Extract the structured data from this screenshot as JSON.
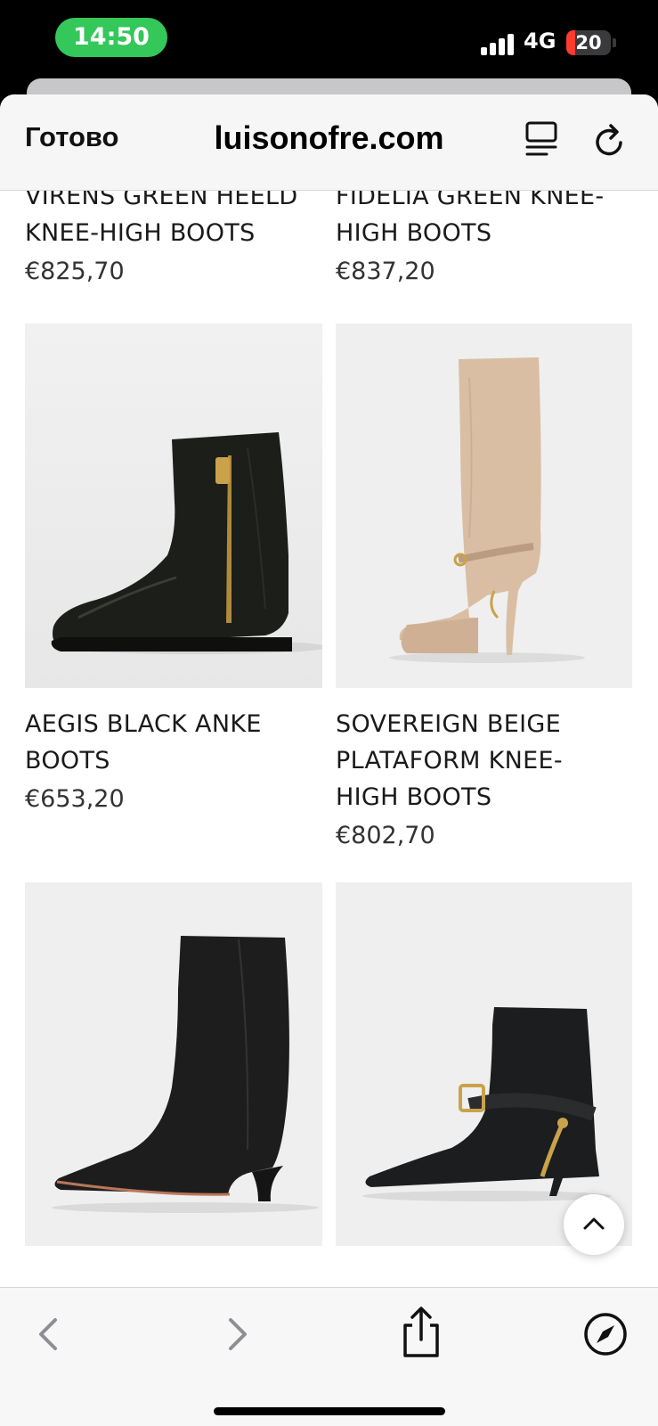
{
  "status": {
    "time": "14:50",
    "network": "4G",
    "battery": "20",
    "battery_level": 0.2
  },
  "browser": {
    "done_label": "Готово",
    "host": "luisonofre.com"
  },
  "products": [
    {
      "name_lines": [
        "VIRENS GREEN HEELD",
        "KNEE-HIGH BOOTS"
      ],
      "price": "€825,70"
    },
    {
      "name_lines": [
        "FIDELIA GREEN KNEE-",
        "HIGH BOOTS"
      ],
      "price": "€837,20"
    },
    {
      "name_lines": [
        "AEGIS BLACK ANKE",
        "BOOTS"
      ],
      "price": "€653,20"
    },
    {
      "name_lines": [
        "SOVEREIGN BEIGE",
        "PLATAFORM KNEE-",
        "HIGH BOOTS"
      ],
      "price": "€802,70"
    }
  ],
  "icons": {
    "reader": "reader-icon",
    "reload": "reload-icon",
    "back": "chevron-left-icon",
    "forward": "chevron-right-icon",
    "share": "share-icon",
    "safari": "compass-icon",
    "scroll_top": "chevron-up-icon"
  },
  "colors": {
    "status_green": "#34c759",
    "battery_red": "#ff3b30"
  }
}
